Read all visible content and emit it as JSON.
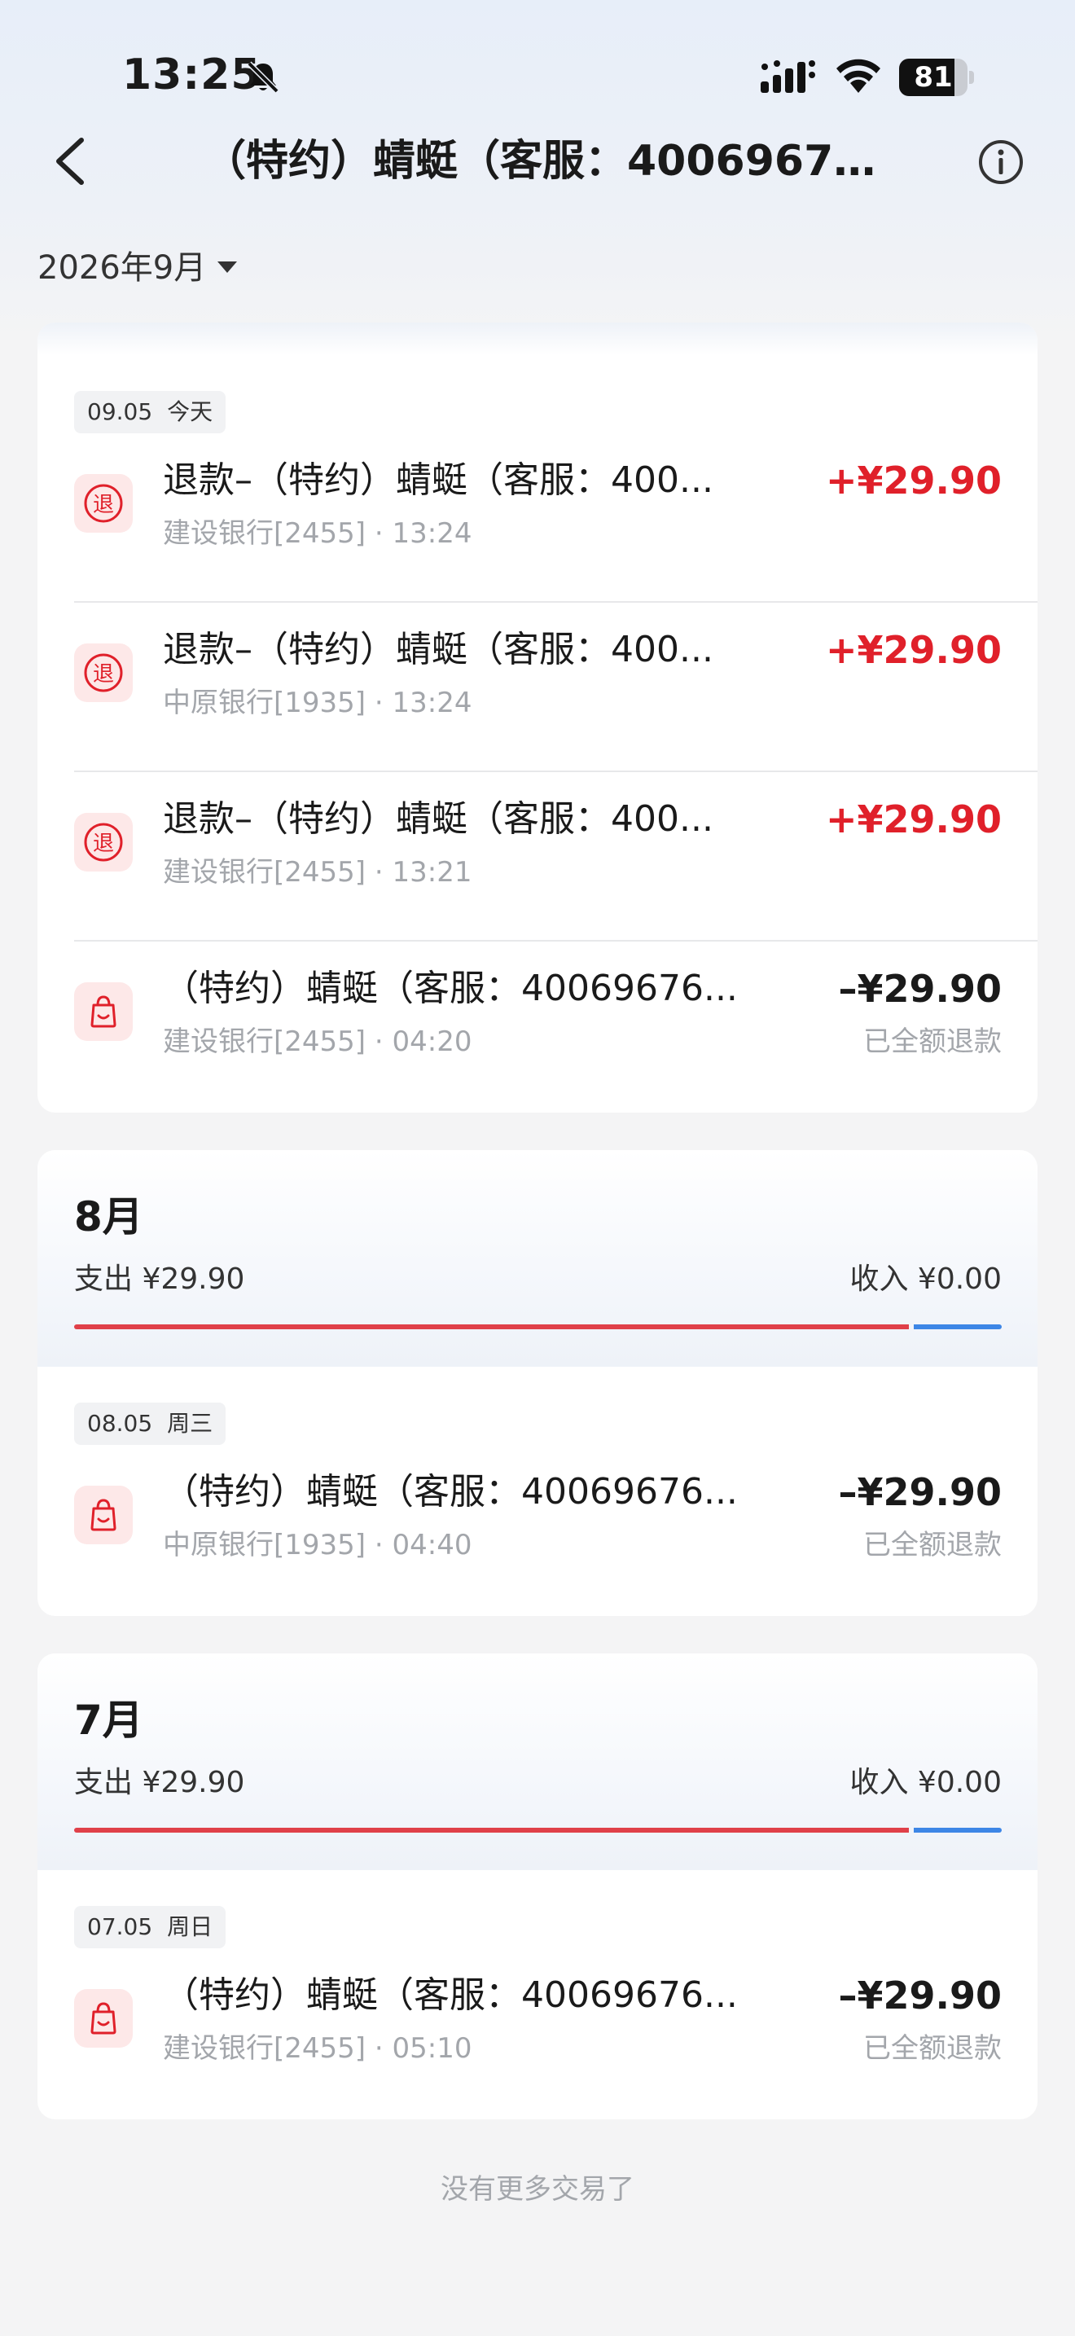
{
  "status_bar": {
    "time": "13:25",
    "battery": "81",
    "battery_level": 0.81
  },
  "nav": {
    "title": "（特约）蜻蜓（客服：40069676..."
  },
  "month_select": {
    "label": "2026年9月"
  },
  "sept": {
    "date_chip": {
      "date": "09.05",
      "day": "今天"
    },
    "transactions": [
      {
        "name": "退款–（特约）蜻蜓（客服：400...",
        "sub": "建设银行[2455] · 13:24",
        "amount": "+¥29.90",
        "icon": "refund-icon"
      },
      {
        "name": "退款–（特约）蜻蜓（客服：400...",
        "sub": "中原银行[1935] · 13:24",
        "amount": "+¥29.90",
        "icon": "refund-icon"
      },
      {
        "name": "退款–（特约）蜻蜓（客服：400...",
        "sub": "建设银行[2455] · 13:21",
        "amount": "+¥29.90",
        "icon": "refund-icon"
      },
      {
        "name": "（特约）蜻蜓（客服：40069676...",
        "sub": "建设银行[2455] · 04:20",
        "amount": "–¥29.90",
        "note": "已全额退款",
        "icon": "shopping-bag-icon"
      }
    ]
  },
  "aug": {
    "title": "8月",
    "expense": "支出 ¥29.90",
    "income": "收入 ¥0.00",
    "expense_ratio": 0.9,
    "date_chip": {
      "date": "08.05",
      "day": "周三"
    },
    "transaction": {
      "name": "（特约）蜻蜓（客服：40069676...",
      "sub": "中原银行[1935] · 04:40",
      "amount": "–¥29.90",
      "note": "已全额退款",
      "icon": "shopping-bag-icon"
    }
  },
  "jul": {
    "title": "7月",
    "expense": "支出 ¥29.90",
    "income": "收入 ¥0.00",
    "expense_ratio": 0.9,
    "date_chip": {
      "date": "07.05",
      "day": "周日"
    },
    "transaction": {
      "name": "（特约）蜻蜓（客服：40069676...",
      "sub": "建设银行[2455] · 05:10",
      "amount": "–¥29.90",
      "note": "已全额退款",
      "icon": "shopping-bag-icon"
    }
  },
  "footer": {
    "end_text": "没有更多交易了"
  },
  "colors": {
    "income_red": "#e0202a",
    "bar_red": "#e04049",
    "bar_blue": "#3d86e6",
    "icon_bg": "#fde8e8"
  }
}
